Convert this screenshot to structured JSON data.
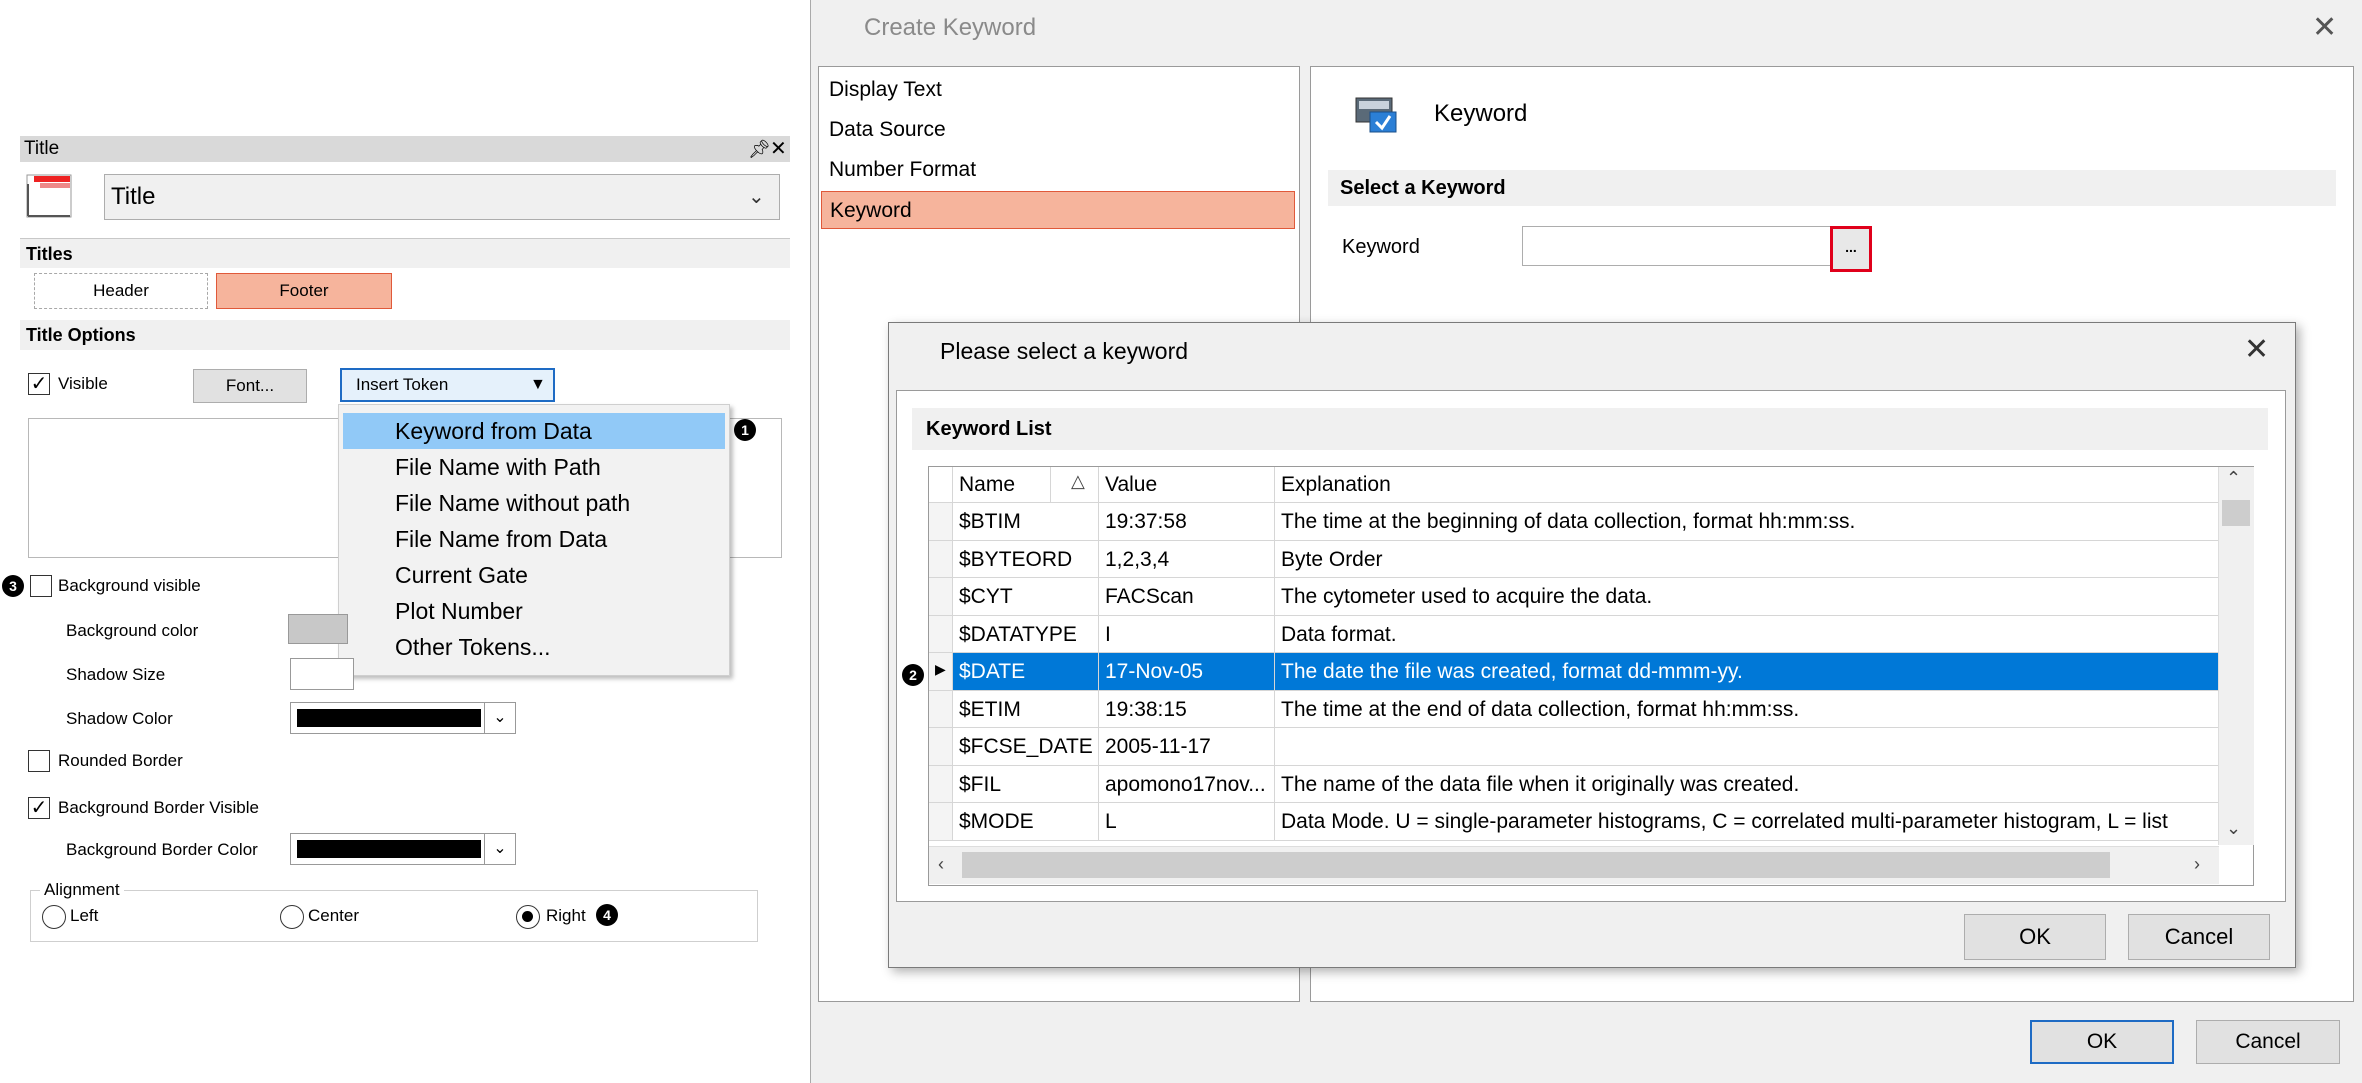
{
  "title_panel": {
    "title": "Title",
    "select_value": "Title",
    "sections": {
      "titles": "Titles",
      "title_options": "Title Options"
    },
    "header_button": "Header",
    "footer_button": "Footer",
    "visible_label": "Visible",
    "visible_checked": true,
    "font_button": "Font...",
    "insert_token": "Insert Token",
    "menu_items": [
      "Keyword from Data",
      "File Name with Path",
      "File Name without path",
      "File Name from Data",
      "Current Gate",
      "Plot Number",
      "Other Tokens..."
    ],
    "menu_selected_index": 0,
    "background_visible_label": "Background visible",
    "background_visible_checked": false,
    "background_color_label": "Background color",
    "shadow_size_label": "Shadow Size",
    "shadow_color_label": "Shadow Color",
    "rounded_border_label": "Rounded Border",
    "rounded_border_checked": false,
    "bg_border_visible_label": "Background Border Visible",
    "bg_border_visible_checked": true,
    "bg_border_color_label": "Background Border Color",
    "alignment_label": "Alignment",
    "alignment_options": [
      "Left",
      "Center",
      "Right"
    ],
    "alignment_selected": "Right",
    "colors": {
      "footer_fill": "#f6b49c",
      "shadow_color": "#000000",
      "border_color": "#000000",
      "background_color": "#c8c8c8"
    }
  },
  "badges": [
    "1",
    "2",
    "3",
    "4"
  ],
  "create_keyword": {
    "title": "Create Keyword",
    "list_items": [
      "Display Text",
      "Data Source",
      "Number Format",
      "Keyword"
    ],
    "selected_index": 3,
    "panel_title": "Keyword",
    "section_header": "Select a Keyword",
    "keyword_label": "Keyword",
    "keyword_value": "",
    "browse_label": "...",
    "ok": "OK",
    "cancel": "Cancel"
  },
  "select_keyword": {
    "title": "Please select a keyword",
    "list_header": "Keyword List",
    "columns": [
      "Name",
      "Value",
      "Explanation"
    ],
    "sort_indicator": "△",
    "rows": [
      {
        "name": "$BTIM",
        "value": "19:37:58",
        "explanation": "The time at the beginning of data collection, format hh:mm:ss."
      },
      {
        "name": "$BYTEORD",
        "value": "1,2,3,4",
        "explanation": "Byte Order"
      },
      {
        "name": "$CYT",
        "value": "FACScan",
        "explanation": "The cytometer used to acquire the data."
      },
      {
        "name": "$DATATYPE",
        "value": "I",
        "explanation": "Data format."
      },
      {
        "name": "$DATE",
        "value": "17-Nov-05",
        "explanation": "The date the file was created, format dd-mmm-yy."
      },
      {
        "name": "$ETIM",
        "value": "19:38:15",
        "explanation": "The time at the end of data collection, format hh:mm:ss."
      },
      {
        "name": "$FCSE_DATE",
        "value": "2005-11-17",
        "explanation": ""
      },
      {
        "name": "$FIL",
        "value": "apomono17nov...",
        "explanation": "The name of the data file when it originally was created."
      },
      {
        "name": "$MODE",
        "value": "L",
        "explanation": "Data Mode.  U = single-parameter histograms, C = correlated multi-parameter histogram, L = list"
      }
    ],
    "selected_row": 4,
    "ok": "OK",
    "cancel": "Cancel"
  }
}
